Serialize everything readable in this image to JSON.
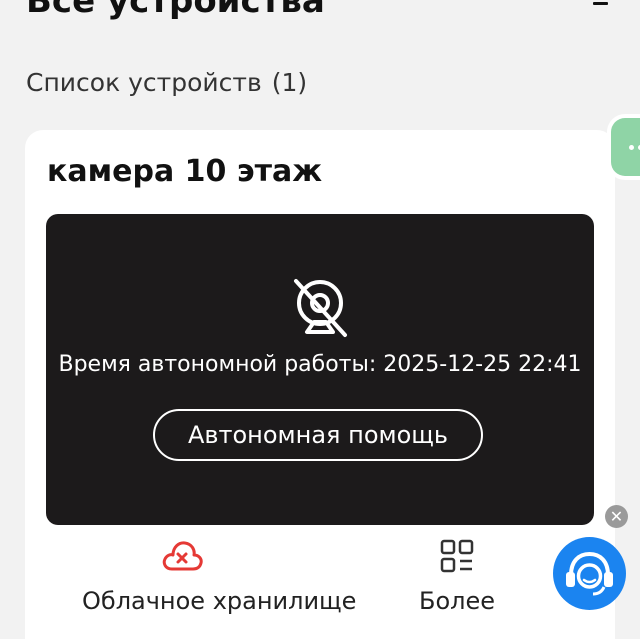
{
  "header": {
    "title": "Все устройства"
  },
  "device_list": {
    "label": "Список устройств",
    "count": "(1)"
  },
  "device_card": {
    "name": "камера 10 этаж",
    "preview": {
      "offline_text": "Время автономной работы: 2025-12-25 22:41",
      "help_button_label": "Автономная помощь"
    },
    "actions": [
      {
        "label": "Облачное хранилище",
        "icon": "cloud-error-icon"
      },
      {
        "label": "Более",
        "icon": "grid-more-icon"
      }
    ]
  },
  "colors": {
    "background": "#f2f2f2",
    "card": "#ffffff",
    "preview_bg": "#1c1a1b",
    "cloud_icon": "#e53935",
    "support_button": "#1b84f0",
    "side_widget": "#8fd4a6"
  },
  "floating": {
    "close_glyph": "✕",
    "support_icon": "headset-support-icon"
  }
}
